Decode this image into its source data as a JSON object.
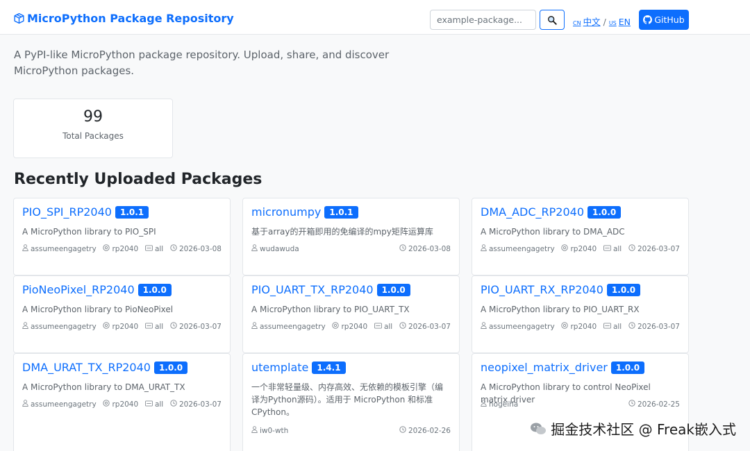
{
  "navbar": {
    "brand": "MicroPython Package Repository",
    "search_placeholder": "example-package...",
    "lang_cn_code": "CN",
    "lang_cn": "中文",
    "lang_sep": "/",
    "lang_us_code": "US",
    "lang_en": "EN",
    "github": "GitHub"
  },
  "intro": "A PyPI-like MicroPython package repository. Upload, share, and discover MicroPython packages.",
  "stats": {
    "count": "99",
    "label": "Total Packages"
  },
  "section_title": "Recently Uploaded Packages",
  "packages": [
    {
      "name": "PIO_SPI_RP2040",
      "version": "1.0.1",
      "desc": "A MicroPython library to PIO_SPI",
      "author": "assumeengagetry",
      "chip": "rp2040",
      "board": "all",
      "date": "2026-03-08"
    },
    {
      "name": "micronumpy",
      "version": "1.0.1",
      "desc": "基于array的开箱即用的免编译的mpy矩阵运算库",
      "author": "wudawuda",
      "date": "2026-03-08"
    },
    {
      "name": "DMA_ADC_RP2040",
      "version": "1.0.0",
      "desc": "A MicroPython library to DMA_ADC",
      "author": "assumeengagetry",
      "chip": "rp2040",
      "board": "all",
      "date": "2026-03-07"
    },
    {
      "name": "PioNeoPixel_RP2040",
      "version": "1.0.0",
      "desc": "A MicroPython library to PioNeoPixel",
      "author": "assumeengagetry",
      "chip": "rp2040",
      "board": "all",
      "date": "2026-03-07"
    },
    {
      "name": "PIO_UART_TX_RP2040",
      "version": "1.0.0",
      "desc": "A MicroPython library to PIO_UART_TX",
      "author": "assumeengagetry",
      "chip": "rp2040",
      "board": "all",
      "date": "2026-03-07"
    },
    {
      "name": "PIO_UART_RX_RP2040",
      "version": "1.0.0",
      "desc": "A MicroPython library to PIO_UART_RX",
      "author": "assumeengagetry",
      "chip": "rp2040",
      "board": "all",
      "date": "2026-03-07"
    },
    {
      "name": "DMA_URAT_TX_RP2040",
      "version": "1.0.0",
      "desc": "A MicroPython library to DMA_URAT_TX",
      "author": "assumeengagetry",
      "chip": "rp2040",
      "board": "all",
      "date": "2026-03-07"
    },
    {
      "name": "utemplate",
      "version": "1.4.1",
      "desc": "一个非常轻量级、内存高效、无依赖的模板引擎（编译为Python源码）。适用于 MicroPython 和标准 CPython。",
      "author": "iw0-wth",
      "date": "2026-02-26"
    },
    {
      "name": "neopixel_matrix_driver",
      "version": "1.0.0",
      "desc": "A MicroPython library to control NeoPixel matrix driver",
      "author": "hogeiha",
      "date": "2026-02-25"
    }
  ],
  "watermark": "掘金技术社区 @ Freak嵌入式",
  "colors": {
    "primary": "#0d6efd",
    "background": "#f8f9fa",
    "muted": "#6c757d"
  }
}
